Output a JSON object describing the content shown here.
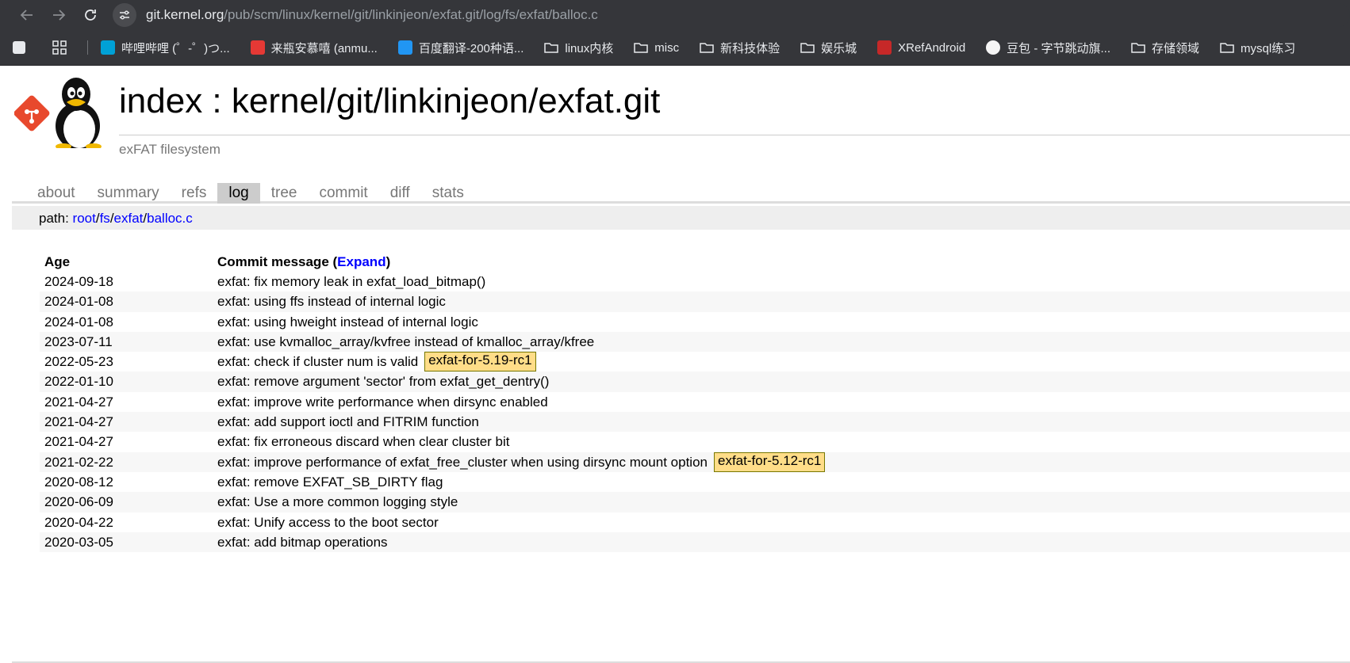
{
  "browser": {
    "url_host": "git.kernel.org",
    "url_path": "/pub/scm/linux/kernel/git/linkinjeon/exfat.git/log/fs/exfat/balloc.c",
    "bookmarks": [
      {
        "label": "哔哩哔哩 (゜-゜)つ...",
        "icon": "bilibili-icon",
        "color": "#00a1d6"
      },
      {
        "label": "来瓶安慕嘻 (anmu...",
        "icon": "g-logo-icon",
        "color": "#e53935"
      },
      {
        "label": "百度翻译-200种语...",
        "icon": "translate-icon",
        "color": "#2196f3"
      },
      {
        "label": "linux内核",
        "icon": "folder-icon"
      },
      {
        "label": "misc",
        "icon": "folder-icon"
      },
      {
        "label": "新科技体验",
        "icon": "folder-icon"
      },
      {
        "label": "娱乐城",
        "icon": "folder-icon"
      },
      {
        "label": "XRefAndroid",
        "icon": "code-icon",
        "color": "#c62828"
      },
      {
        "label": "豆包 - 字节跳动旗...",
        "icon": "doubao-icon",
        "color": "#f5f5f5"
      },
      {
        "label": "存储领域",
        "icon": "folder-icon"
      },
      {
        "label": "mysql练习",
        "icon": "folder-icon"
      }
    ]
  },
  "header": {
    "title": "index : kernel/git/linkinjeon/exfat.git",
    "description": "exFAT filesystem"
  },
  "tabs": [
    "about",
    "summary",
    "refs",
    "log",
    "tree",
    "commit",
    "diff",
    "stats"
  ],
  "active_tab": "log",
  "path": {
    "label": "path: ",
    "parts": [
      "root",
      "fs",
      "exfat",
      "balloc.c"
    ]
  },
  "log": {
    "age_header": "Age",
    "msg_header": "Commit message (",
    "expand_label": "Expand",
    "msg_header_end": ")",
    "rows": [
      {
        "age": "2024-09-18",
        "msg": "exfat: fix memory leak in exfat_load_bitmap()",
        "tag": ""
      },
      {
        "age": "2024-01-08",
        "msg": "exfat: using ffs instead of internal logic",
        "tag": ""
      },
      {
        "age": "2024-01-08",
        "msg": "exfat: using hweight instead of internal logic",
        "tag": ""
      },
      {
        "age": "2023-07-11",
        "msg": "exfat: use kvmalloc_array/kvfree instead of kmalloc_array/kfree",
        "tag": ""
      },
      {
        "age": "2022-05-23",
        "msg": "exfat: check if cluster num is valid",
        "tag": "exfat-for-5.19-rc1"
      },
      {
        "age": "2022-01-10",
        "msg": "exfat: remove argument 'sector' from exfat_get_dentry()",
        "tag": ""
      },
      {
        "age": "2021-04-27",
        "msg": "exfat: improve write performance when dirsync enabled",
        "tag": ""
      },
      {
        "age": "2021-04-27",
        "msg": "exfat: add support ioctl and FITRIM function",
        "tag": ""
      },
      {
        "age": "2021-04-27",
        "msg": "exfat: fix erroneous discard when clear cluster bit",
        "tag": ""
      },
      {
        "age": "2021-02-22",
        "msg": "exfat: improve performance of exfat_free_cluster when using dirsync mount option",
        "tag": "exfat-for-5.12-rc1"
      },
      {
        "age": "2020-08-12",
        "msg": "exfat: remove EXFAT_SB_DIRTY flag",
        "tag": ""
      },
      {
        "age": "2020-06-09",
        "msg": "exfat: Use a more common logging style",
        "tag": ""
      },
      {
        "age": "2020-04-22",
        "msg": "exfat: Unify access to the boot sector",
        "tag": ""
      },
      {
        "age": "2020-03-05",
        "msg": "exfat: add bitmap operations",
        "tag": ""
      }
    ]
  }
}
